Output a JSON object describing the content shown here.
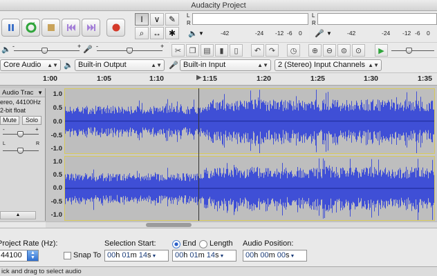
{
  "window": {
    "title": "Audacity Project"
  },
  "transport": {
    "buttons": [
      {
        "name": "pause-button",
        "icon": "pause-icon"
      },
      {
        "name": "play-button",
        "icon": "play-loop-icon"
      },
      {
        "name": "stop-button",
        "icon": "stop-icon"
      },
      {
        "name": "skip-start-button",
        "icon": "skip-start-icon"
      },
      {
        "name": "skip-end-button",
        "icon": "skip-end-icon"
      },
      {
        "name": "record-button",
        "icon": "record-icon"
      }
    ]
  },
  "tools": {
    "selection": "I",
    "envelope": "∨",
    "draw": "✎",
    "zoom": "⌕",
    "timeshift": "↔",
    "multi": "✱"
  },
  "meters": {
    "channel_l": "L",
    "channel_r": "R",
    "scale_left": [
      "-42",
      "-24",
      "-12",
      "-6",
      "0"
    ],
    "scale_right": [
      "-42",
      "-24",
      "-12",
      "-6",
      "0"
    ]
  },
  "mixer": {
    "minus": "-",
    "plus": "+"
  },
  "devices": {
    "host": "Core Audio",
    "output": "Built-in Output",
    "input": "Built-in Input",
    "channels": "2 (Stereo) Input Channels"
  },
  "ruler": {
    "labels": [
      "1:00",
      "1:05",
      "1:10",
      "1:15",
      "1:20",
      "1:25",
      "1:30",
      "1:35"
    ]
  },
  "track": {
    "name": "Audio Trac",
    "info1": "ereo, 44100Hz",
    "info2": "2-bit float",
    "mute": "Mute",
    "solo": "Solo",
    "gain_minus": "-",
    "gain_plus": "+",
    "pan_l": "L",
    "pan_r": "R",
    "scale_top": [
      "1.0",
      "0.5",
      "0.0",
      "-0.5",
      "-1.0"
    ],
    "scale_bottom": [
      "1.0",
      "0.5",
      "0.0",
      "-0.5",
      "-1.0"
    ]
  },
  "bottom": {
    "project_rate_label": "Project Rate (Hz):",
    "project_rate": "44100",
    "snap_to": "Snap To",
    "selection_start_label": "Selection Start:",
    "end_label": "End",
    "length_label": "Length",
    "audio_position_label": "Audio Position:",
    "sel_start": {
      "h": "00",
      "m": "01",
      "s": "14"
    },
    "sel_end": {
      "h": "00",
      "m": "01",
      "s": "14"
    },
    "audio_pos": {
      "h": "00",
      "m": "00",
      "s": "00"
    },
    "unit_h": "h",
    "unit_m": "m",
    "unit_s": "s"
  },
  "status": {
    "text": "ick and drag to select audio"
  },
  "colors": {
    "waveform": "#3f4fd6",
    "record": "#d43a2a",
    "play": "#2fa53b",
    "accent": "#3a6fc8"
  }
}
